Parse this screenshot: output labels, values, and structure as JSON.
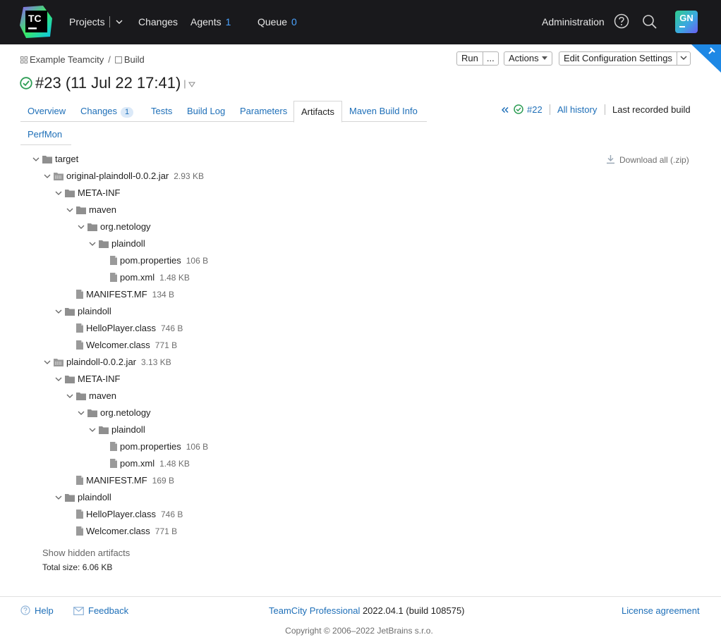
{
  "header": {
    "logo_text": "TC",
    "nav": {
      "projects": "Projects",
      "changes": "Changes",
      "agents": "Agents",
      "agents_count": "1",
      "queue": "Queue",
      "queue_count": "0"
    },
    "administration": "Administration",
    "avatar_initials": "GN"
  },
  "breadcrumb": {
    "project": "Example Teamcity",
    "separator": "/",
    "build_config": "Build"
  },
  "toolbar": {
    "run": "Run",
    "run_more": "...",
    "actions": "Actions",
    "edit_settings": "Edit Configuration Settings"
  },
  "build": {
    "title": "#23 (11 Jul 22 17:41)",
    "status_color": "#2e9d55"
  },
  "tabs": [
    {
      "label": "Overview"
    },
    {
      "label": "Changes",
      "badge": "1"
    },
    {
      "label": "Tests"
    },
    {
      "label": "Build Log"
    },
    {
      "label": "Parameters"
    },
    {
      "label": "Artifacts"
    },
    {
      "label": "Maven Build Info"
    },
    {
      "label": "PerfMon"
    }
  ],
  "history": {
    "prev_build": "#22",
    "all_history": "All history",
    "last_recorded": "Last recorded build"
  },
  "artifacts": {
    "download_all": "Download all (.zip)",
    "tree": [
      {
        "name": "target",
        "size": "",
        "type": "folder",
        "depth": 0
      },
      {
        "name": "original-plaindoll-0.0.2.jar",
        "size": "2.93 KB",
        "type": "archive",
        "depth": 1
      },
      {
        "name": "META-INF",
        "size": "",
        "type": "folder",
        "depth": 2
      },
      {
        "name": "maven",
        "size": "",
        "type": "folder",
        "depth": 3
      },
      {
        "name": "org.netology",
        "size": "",
        "type": "folder",
        "depth": 4
      },
      {
        "name": "plaindoll",
        "size": "",
        "type": "folder",
        "depth": 5
      },
      {
        "name": "pom.properties",
        "size": "106 B",
        "type": "file",
        "depth": 6
      },
      {
        "name": "pom.xml",
        "size": "1.48 KB",
        "type": "file",
        "depth": 6
      },
      {
        "name": "MANIFEST.MF",
        "size": "134 B",
        "type": "file",
        "depth": 3
      },
      {
        "name": "plaindoll",
        "size": "",
        "type": "folder",
        "depth": 2
      },
      {
        "name": "HelloPlayer.class",
        "size": "746 B",
        "type": "file",
        "depth": 3
      },
      {
        "name": "Welcomer.class",
        "size": "771 B",
        "type": "file",
        "depth": 3
      },
      {
        "name": "plaindoll-0.0.2.jar",
        "size": "3.13 KB",
        "type": "archive",
        "depth": 1
      },
      {
        "name": "META-INF",
        "size": "",
        "type": "folder",
        "depth": 2
      },
      {
        "name": "maven",
        "size": "",
        "type": "folder",
        "depth": 3
      },
      {
        "name": "org.netology",
        "size": "",
        "type": "folder",
        "depth": 4
      },
      {
        "name": "plaindoll",
        "size": "",
        "type": "folder",
        "depth": 5
      },
      {
        "name": "pom.properties",
        "size": "106 B",
        "type": "file",
        "depth": 6
      },
      {
        "name": "pom.xml",
        "size": "1.48 KB",
        "type": "file",
        "depth": 6
      },
      {
        "name": "MANIFEST.MF",
        "size": "169 B",
        "type": "file",
        "depth": 3
      },
      {
        "name": "plaindoll",
        "size": "",
        "type": "folder",
        "depth": 2
      },
      {
        "name": "HelloPlayer.class",
        "size": "746 B",
        "type": "file",
        "depth": 3
      },
      {
        "name": "Welcomer.class",
        "size": "771 B",
        "type": "file",
        "depth": 3
      }
    ],
    "show_hidden": "Show hidden artifacts",
    "total_size": "Total size: 6.06 KB"
  },
  "footer": {
    "help": "Help",
    "feedback": "Feedback",
    "product": "TeamCity Professional",
    "version": "2022.04.1 (build 108575)",
    "license": "License agreement",
    "copyright": "Copyright © 2006–2022 JetBrains s.r.o."
  },
  "colors": {
    "link": "#1e6fb8",
    "header_bg": "#19191c",
    "success": "#2e9d55",
    "ribbon": "#1e88e5"
  }
}
